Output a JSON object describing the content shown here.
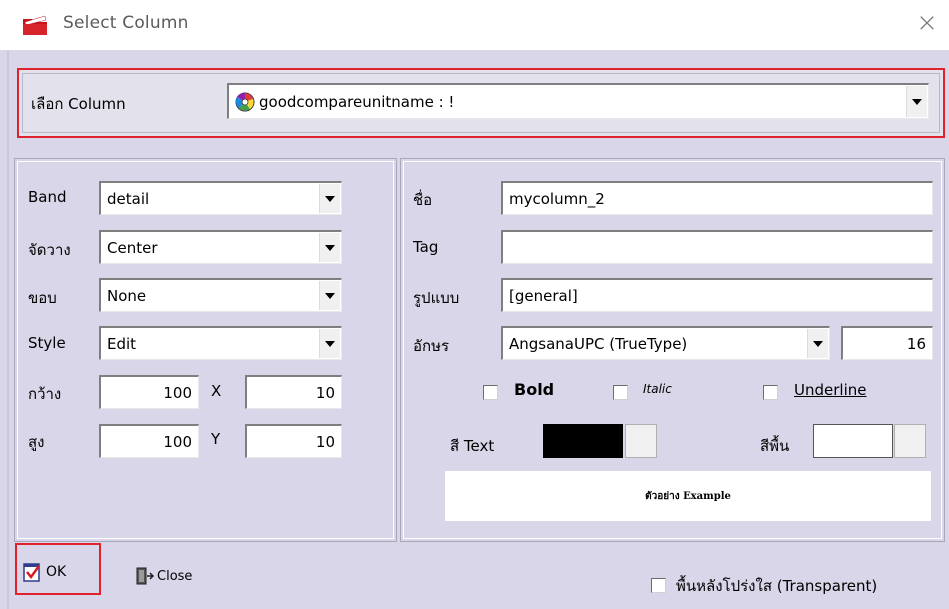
{
  "window": {
    "title": "Select Column",
    "close_glyph": "×",
    "app_icon": "folder-red-icon"
  },
  "column_select": {
    "label": "เลือก Column",
    "value": "goodcompareunitname : !",
    "item_icon": "color-wheel-icon"
  },
  "left_panel": {
    "band": {
      "label": "Band",
      "value": "detail"
    },
    "align": {
      "label": "จัดวาง",
      "value": "Center"
    },
    "border": {
      "label": "ขอบ",
      "value": "None"
    },
    "style": {
      "label": "Style",
      "value": "Edit"
    },
    "width": {
      "label": "กว้าง",
      "value": "100"
    },
    "x": {
      "label": "X",
      "value": "10"
    },
    "height": {
      "label": "สูง",
      "value": "100"
    },
    "y": {
      "label": "Y",
      "value": "10"
    }
  },
  "right_panel": {
    "name": {
      "label": "ชื่อ",
      "value": "mycolumn_2"
    },
    "tag": {
      "label": "Tag",
      "value": ""
    },
    "format": {
      "label": "รูปแบบ",
      "value": "[general]"
    },
    "font": {
      "label": "อักษร",
      "value": "AngsanaUPC (TrueType)",
      "size": "16"
    },
    "bold": {
      "label": "Bold",
      "checked": false
    },
    "italic": {
      "label": "Italic",
      "checked": false
    },
    "underline": {
      "label": "Underline",
      "checked": false
    },
    "text_color": {
      "label": "สี Text",
      "color": "#000000"
    },
    "bg_color": {
      "label": "สีพื้น",
      "color": "#ffffff"
    },
    "preview": "ตัวอย่าง Example"
  },
  "footer": {
    "ok_label": "OK",
    "close_label": "Close",
    "transparent_label": "พื้นหลังโปร่งใส (Transparent)",
    "transparent_checked": false
  },
  "colors": {
    "dialog_bg": "#d8d6e8",
    "highlight": "#e0222c"
  }
}
